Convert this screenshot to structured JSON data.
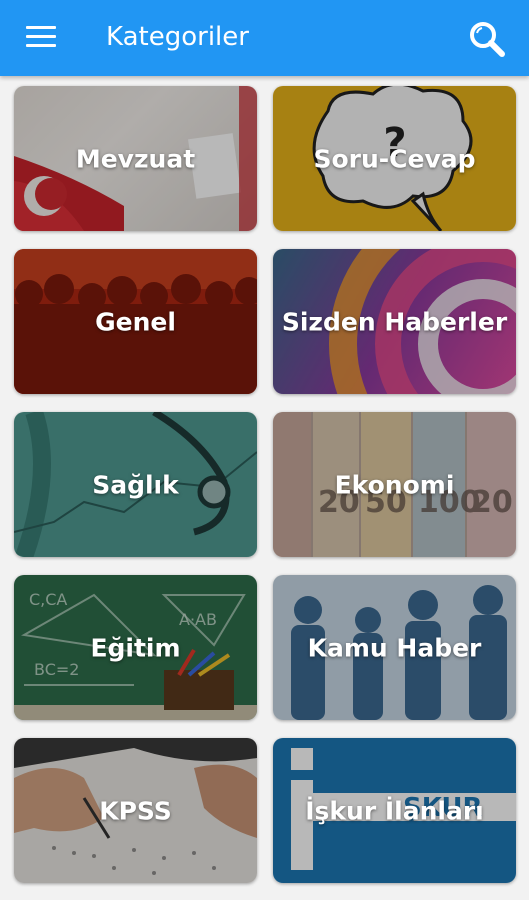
{
  "header": {
    "title": "Kategoriler",
    "menu_icon": "hamburger-menu-icon",
    "search_icon": "search-icon",
    "background_color": "#2196f3"
  },
  "categories": [
    {
      "label": "Mevzuat"
    },
    {
      "label": "Soru-Cevap"
    },
    {
      "label": "Genel"
    },
    {
      "label": "Sizden Haberler"
    },
    {
      "label": "Sağlık"
    },
    {
      "label": "Ekonomi"
    },
    {
      "label": "Eğitim"
    },
    {
      "label": "Kamu Haber"
    },
    {
      "label": "KPSS"
    },
    {
      "label": "İşkur İlanları"
    }
  ]
}
